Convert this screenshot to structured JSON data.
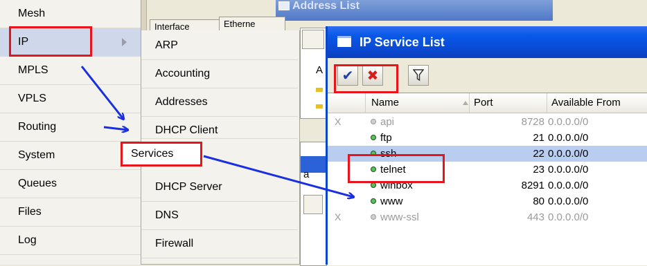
{
  "background_window": {
    "title": "Address List",
    "tab_interface": "Interface",
    "tab_ethernet": "Etherne",
    "column_fragment": "A",
    "fragment_a": "a"
  },
  "menu": {
    "items": [
      {
        "label": "Mesh"
      },
      {
        "label": "IP"
      },
      {
        "label": "MPLS"
      },
      {
        "label": "VPLS"
      },
      {
        "label": "Routing"
      },
      {
        "label": "System"
      },
      {
        "label": "Queues"
      },
      {
        "label": "Files"
      },
      {
        "label": "Log"
      }
    ]
  },
  "submenu": {
    "items": [
      {
        "label": "ARP"
      },
      {
        "label": "Accounting"
      },
      {
        "label": "Addresses"
      },
      {
        "label": "DHCP Client"
      },
      {
        "label": "Services"
      },
      {
        "label": "DHCP Server"
      },
      {
        "label": "DNS"
      },
      {
        "label": "Firewall"
      }
    ]
  },
  "service_window": {
    "title": "IP Service List",
    "toolbar": {
      "enable_icon": "checkmark-icon",
      "disable_icon": "x-icon",
      "filter_icon": "filter-icon"
    },
    "columns": {
      "name": "Name",
      "port": "Port",
      "available_from": "Available From"
    },
    "rows": [
      {
        "name": "api",
        "port": "8728",
        "available_from": "0.0.0.0/0",
        "disabled": true
      },
      {
        "name": "ftp",
        "port": "21",
        "available_from": "0.0.0.0/0",
        "disabled": false
      },
      {
        "name": "ssh",
        "port": "22",
        "available_from": "0.0.0.0/0",
        "disabled": false,
        "selected": true
      },
      {
        "name": "telnet",
        "port": "23",
        "available_from": "0.0.0.0/0",
        "disabled": false
      },
      {
        "name": "winbox",
        "port": "8291",
        "available_from": "0.0.0.0/0",
        "disabled": false
      },
      {
        "name": "www",
        "port": "80",
        "available_from": "0.0.0.0/0",
        "disabled": false
      },
      {
        "name": "www-ssl",
        "port": "443",
        "available_from": "0.0.0.0/0",
        "disabled": true
      }
    ],
    "disabled_mark": "X"
  },
  "colors": {
    "highlight_red": "#e8141c",
    "arrow_blue": "#1a2fe0",
    "titlebar_blue": "#0a4ad4",
    "selection": "#b8cdf0"
  }
}
